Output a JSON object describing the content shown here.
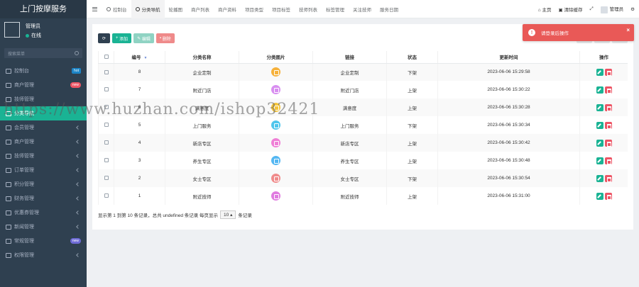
{
  "app": {
    "title": "上门按摩服务"
  },
  "profile": {
    "name": "管理员",
    "status": "在线"
  },
  "sidebar": {
    "search_placeholder": "搜索菜单",
    "items": [
      {
        "label": "控制台",
        "icon": "dashboard-icon",
        "badge": "hot",
        "badge_color": "#1c84c6"
      },
      {
        "label": "商户管理",
        "icon": "store-icon",
        "badge": "new",
        "badge_color": "#ed5565"
      },
      {
        "label": "技师管理",
        "icon": "worker-icon"
      },
      {
        "label": "分类导航",
        "icon": "category-icon",
        "active": true
      },
      {
        "label": "会员管理",
        "icon": "list-icon",
        "arrow": true
      },
      {
        "label": "商户管理",
        "icon": "shop-icon",
        "arrow": true
      },
      {
        "label": "技师管理",
        "icon": "people-icon",
        "arrow": true
      },
      {
        "label": "订单管理",
        "icon": "order-icon",
        "arrow": true
      },
      {
        "label": "积分管理",
        "icon": "points-icon",
        "arrow": true
      },
      {
        "label": "财务管理",
        "icon": "finance-icon",
        "arrow": true
      },
      {
        "label": "优惠券管理",
        "icon": "coupon-icon",
        "arrow": true
      },
      {
        "label": "新闻管理",
        "icon": "news-icon",
        "arrow": true
      },
      {
        "label": "常规管理",
        "icon": "gear-icon",
        "badge": "new",
        "badge_color": "#6e6bd6"
      },
      {
        "label": "权限管理",
        "icon": "permission-icon",
        "arrow": true
      }
    ]
  },
  "topbar": {
    "tabs": [
      {
        "label": "控制台",
        "current": false
      },
      {
        "label": "分类导航",
        "current": true
      },
      {
        "label": "轮播图",
        "current": false
      },
      {
        "label": "商户列表",
        "current": false
      },
      {
        "label": "商户资料",
        "current": false
      },
      {
        "label": "项目类型",
        "current": false
      },
      {
        "label": "项目标签",
        "current": false
      },
      {
        "label": "技师列表",
        "current": false
      },
      {
        "label": "标签管理",
        "current": false
      },
      {
        "label": "关注技师",
        "current": false
      },
      {
        "label": "服务日期",
        "current": false
      }
    ],
    "home": "主页",
    "clear_cache": "清除缓存",
    "user": "管理员"
  },
  "toolbar": {
    "add": "添加",
    "edit": "编辑",
    "delete": "删除"
  },
  "table": {
    "headers": [
      "编号",
      "分类名称",
      "分类图片",
      "链接",
      "状态",
      "更新时间",
      "操作"
    ],
    "rows": [
      {
        "id": "8",
        "name": "企业定制",
        "icon_color": "#f6b13a",
        "link": "企业定制",
        "status": "下架",
        "updated": "2023-06-06 15:29:58"
      },
      {
        "id": "7",
        "name": "附近门店",
        "icon_color": "#d88ef0",
        "link": "附近门店",
        "status": "上架",
        "updated": "2023-06-06 15:30:22"
      },
      {
        "id": "6",
        "name": "满意度",
        "icon_color": "#f5c53b",
        "link": "满意度",
        "status": "上架",
        "updated": "2023-06-06 15:30:28"
      },
      {
        "id": "5",
        "name": "上门服务",
        "icon_color": "#4fc6ec",
        "link": "上门服务",
        "status": "下架",
        "updated": "2023-06-06 15:30:34"
      },
      {
        "id": "4",
        "name": "新店专区",
        "icon_color": "#ef7fd6",
        "link": "新店专区",
        "status": "上架",
        "updated": "2023-06-06 15:30:42"
      },
      {
        "id": "3",
        "name": "养生专区",
        "icon_color": "#54b7f2",
        "link": "养生专区",
        "status": "上架",
        "updated": "2023-06-06 15:30:48"
      },
      {
        "id": "2",
        "name": "女士专区",
        "icon_color": "#f08b8b",
        "link": "女士专区",
        "status": "下架",
        "updated": "2023-06-06 15:30:54"
      },
      {
        "id": "1",
        "name": "附近技师",
        "icon_color": "#e07be0",
        "link": "附近技师",
        "status": "上架",
        "updated": "2023-06-06 15:31:00"
      }
    ]
  },
  "pager": {
    "summary": "显示第 1 到第 10 条记录，总共 undefined 条记录 每页显示",
    "page_size": "10",
    "suffix": "条记录"
  },
  "toast": {
    "message": "请登录后操作",
    "close": "×"
  },
  "watermark": "https://www.huzhan.com/ishop32421"
}
